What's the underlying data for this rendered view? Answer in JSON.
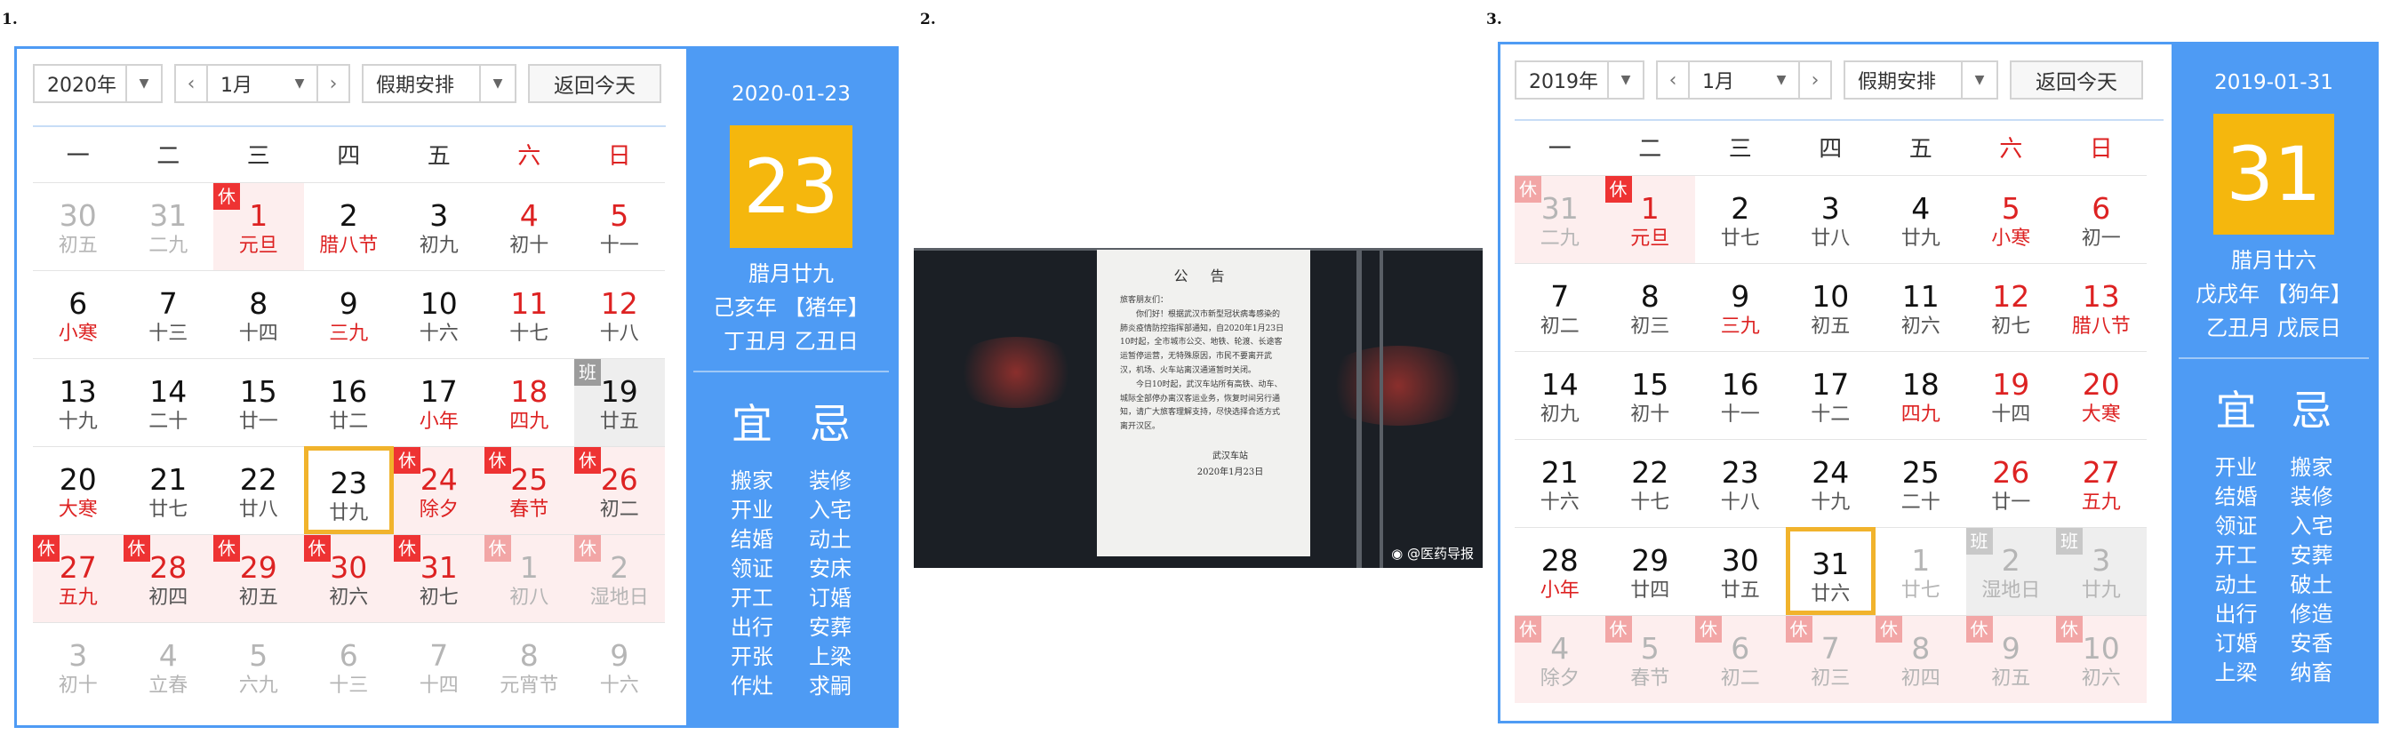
{
  "labels": {
    "one": "1.",
    "two": "2.",
    "three": "3."
  },
  "cal1": {
    "year": "2020年",
    "month": "1月",
    "holiday": "假期安排",
    "today_btn": "返回今天",
    "weekdays": [
      "一",
      "二",
      "三",
      "四",
      "五",
      "六",
      "日"
    ],
    "side": {
      "date": "2020-01-23",
      "day": "23",
      "lunar": "腊月廿九",
      "ganzhi_year": "己亥年 【猪年】",
      "ganzhi_day": "丁丑月 乙丑日",
      "yi": "宜",
      "ji": "忌",
      "yi_items": [
        "搬家",
        "开业",
        "结婚",
        "领证",
        "开工",
        "出行",
        "开张",
        "作灶"
      ],
      "ji_items": [
        "装修",
        "入宅",
        "动土",
        "安床",
        "订婚",
        "安葬",
        "上梁",
        "求嗣"
      ]
    },
    "cells": [
      {
        "d": "30",
        "l": "初五",
        "t": "other"
      },
      {
        "d": "31",
        "l": "二九",
        "t": "other"
      },
      {
        "d": "1",
        "l": "元旦",
        "t": "red hl hol",
        "b": "休"
      },
      {
        "d": "2",
        "l": "腊八节",
        "t": "hl"
      },
      {
        "d": "3",
        "l": "初九",
        "t": ""
      },
      {
        "d": "4",
        "l": "初十",
        "t": "red"
      },
      {
        "d": "5",
        "l": "十一",
        "t": "red"
      },
      {
        "d": "6",
        "l": "小寒",
        "t": "hl"
      },
      {
        "d": "7",
        "l": "十三",
        "t": ""
      },
      {
        "d": "8",
        "l": "十四",
        "t": ""
      },
      {
        "d": "9",
        "l": "三九",
        "t": "hl"
      },
      {
        "d": "10",
        "l": "十六",
        "t": ""
      },
      {
        "d": "11",
        "l": "十七",
        "t": "red"
      },
      {
        "d": "12",
        "l": "十八",
        "t": "red"
      },
      {
        "d": "13",
        "l": "十九",
        "t": ""
      },
      {
        "d": "14",
        "l": "二十",
        "t": ""
      },
      {
        "d": "15",
        "l": "廿一",
        "t": ""
      },
      {
        "d": "16",
        "l": "廿二",
        "t": ""
      },
      {
        "d": "17",
        "l": "小年",
        "t": "hl"
      },
      {
        "d": "18",
        "l": "四九",
        "t": "red hl"
      },
      {
        "d": "19",
        "l": "廿五",
        "t": "work",
        "b": "班"
      },
      {
        "d": "20",
        "l": "大寒",
        "t": "hl"
      },
      {
        "d": "21",
        "l": "廿七",
        "t": ""
      },
      {
        "d": "22",
        "l": "廿八",
        "t": ""
      },
      {
        "d": "23",
        "l": "廿九",
        "t": "today"
      },
      {
        "d": "24",
        "l": "除夕",
        "t": "red hl hol",
        "b": "休"
      },
      {
        "d": "25",
        "l": "春节",
        "t": "red hl hol",
        "b": "休"
      },
      {
        "d": "26",
        "l": "初二",
        "t": "red hol",
        "b": "休"
      },
      {
        "d": "27",
        "l": "五九",
        "t": "red hl hol",
        "b": "休"
      },
      {
        "d": "28",
        "l": "初四",
        "t": "red hol",
        "b": "休"
      },
      {
        "d": "29",
        "l": "初五",
        "t": "red hol",
        "b": "休"
      },
      {
        "d": "30",
        "l": "初六",
        "t": "red hol",
        "b": "休"
      },
      {
        "d": "31",
        "l": "初七",
        "t": "red hol",
        "b": "休"
      },
      {
        "d": "1",
        "l": "初八",
        "t": "other hol",
        "b": "休",
        "f": true
      },
      {
        "d": "2",
        "l": "湿地日",
        "t": "other hol",
        "b": "休",
        "f": true
      },
      {
        "d": "3",
        "l": "初十",
        "t": "other"
      },
      {
        "d": "4",
        "l": "立春",
        "t": "other"
      },
      {
        "d": "5",
        "l": "六九",
        "t": "other"
      },
      {
        "d": "6",
        "l": "十三",
        "t": "other"
      },
      {
        "d": "7",
        "l": "十四",
        "t": "other"
      },
      {
        "d": "8",
        "l": "元宵节",
        "t": "other"
      },
      {
        "d": "9",
        "l": "十六",
        "t": "other"
      }
    ]
  },
  "notice": {
    "title": "公 告",
    "greeting": "旅客朋友们：",
    "p1": "你们好！根据武汉市新型冠状病毒感染的肺炎疫情防控指挥部通知，自2020年1月23日10时起，全市城市公交、地铁、轮渡、长途客运暂停运营，无特殊原因，市民不要离开武汉，机场、火车站离汉通道暂时关闭。",
    "p2": "今日10时起，武汉车站所有高铁、动车、城际全部停办离汉客运业务，恢复时间另行通知，请广大旅客理解支持，尽快选择合适方式离开汉区。",
    "sign": "武汉车站",
    "date": "2020年1月23日",
    "watermark": "@医药导报"
  },
  "cal3": {
    "year": "2019年",
    "month": "1月",
    "holiday": "假期安排",
    "today_btn": "返回今天",
    "weekdays": [
      "一",
      "二",
      "三",
      "四",
      "五",
      "六",
      "日"
    ],
    "side": {
      "date": "2019-01-31",
      "day": "31",
      "lunar": "腊月廿六",
      "ganzhi_year": "戊戌年 【狗年】",
      "ganzhi_day": "乙丑月 戊辰日",
      "yi": "宜",
      "ji": "忌",
      "yi_items": [
        "开业",
        "结婚",
        "领证",
        "开工",
        "动土",
        "出行",
        "订婚",
        "上梁"
      ],
      "ji_items": [
        "搬家",
        "装修",
        "入宅",
        "安葬",
        "破土",
        "修造",
        "安香",
        "纳畜"
      ]
    },
    "cells": [
      {
        "d": "31",
        "l": "二九",
        "t": "other hol",
        "b": "休",
        "f": true
      },
      {
        "d": "1",
        "l": "元旦",
        "t": "red hl hol",
        "b": "休"
      },
      {
        "d": "2",
        "l": "廿七",
        "t": ""
      },
      {
        "d": "3",
        "l": "廿八",
        "t": ""
      },
      {
        "d": "4",
        "l": "廿九",
        "t": ""
      },
      {
        "d": "5",
        "l": "小寒",
        "t": "red hl"
      },
      {
        "d": "6",
        "l": "初一",
        "t": "red"
      },
      {
        "d": "7",
        "l": "初二",
        "t": ""
      },
      {
        "d": "8",
        "l": "初三",
        "t": ""
      },
      {
        "d": "9",
        "l": "三九",
        "t": "hl"
      },
      {
        "d": "10",
        "l": "初五",
        "t": ""
      },
      {
        "d": "11",
        "l": "初六",
        "t": ""
      },
      {
        "d": "12",
        "l": "初七",
        "t": "red"
      },
      {
        "d": "13",
        "l": "腊八节",
        "t": "red hl"
      },
      {
        "d": "14",
        "l": "初九",
        "t": ""
      },
      {
        "d": "15",
        "l": "初十",
        "t": ""
      },
      {
        "d": "16",
        "l": "十一",
        "t": ""
      },
      {
        "d": "17",
        "l": "十二",
        "t": ""
      },
      {
        "d": "18",
        "l": "四九",
        "t": "hl"
      },
      {
        "d": "19",
        "l": "十四",
        "t": "red"
      },
      {
        "d": "20",
        "l": "大寒",
        "t": "red hl"
      },
      {
        "d": "21",
        "l": "十六",
        "t": ""
      },
      {
        "d": "22",
        "l": "十七",
        "t": ""
      },
      {
        "d": "23",
        "l": "十八",
        "t": ""
      },
      {
        "d": "24",
        "l": "十九",
        "t": ""
      },
      {
        "d": "25",
        "l": "二十",
        "t": ""
      },
      {
        "d": "26",
        "l": "廿一",
        "t": "red"
      },
      {
        "d": "27",
        "l": "五九",
        "t": "red hl"
      },
      {
        "d": "28",
        "l": "小年",
        "t": "hl"
      },
      {
        "d": "29",
        "l": "廿四",
        "t": ""
      },
      {
        "d": "30",
        "l": "廿五",
        "t": ""
      },
      {
        "d": "31",
        "l": "廿六",
        "t": "today"
      },
      {
        "d": "1",
        "l": "廿七",
        "t": "other"
      },
      {
        "d": "2",
        "l": "湿地日",
        "t": "other work",
        "b": "班",
        "f": true
      },
      {
        "d": "3",
        "l": "廿九",
        "t": "other work",
        "b": "班",
        "f": true
      },
      {
        "d": "4",
        "l": "除夕",
        "t": "other hol",
        "b": "休",
        "f": true
      },
      {
        "d": "5",
        "l": "春节",
        "t": "other hol",
        "b": "休",
        "f": true
      },
      {
        "d": "6",
        "l": "初二",
        "t": "other hol",
        "b": "休",
        "f": true
      },
      {
        "d": "7",
        "l": "初三",
        "t": "other hol",
        "b": "休",
        "f": true
      },
      {
        "d": "8",
        "l": "初四",
        "t": "other hol",
        "b": "休",
        "f": true
      },
      {
        "d": "9",
        "l": "初五",
        "t": "other hol",
        "b": "休",
        "f": true
      },
      {
        "d": "10",
        "l": "初六",
        "t": "other hol",
        "b": "休",
        "f": true
      }
    ]
  }
}
